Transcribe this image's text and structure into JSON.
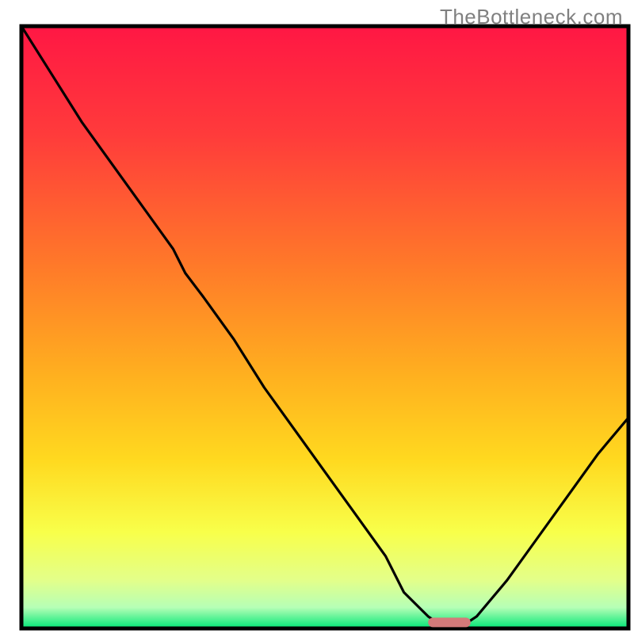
{
  "watermark": "TheBottleneck.com",
  "chart_data": {
    "type": "line",
    "title": "",
    "xlabel": "",
    "ylabel": "",
    "xlim": [
      0,
      100
    ],
    "ylim": [
      0,
      100
    ],
    "legend": false,
    "grid": false,
    "curve": {
      "name": "bottleneck-curve",
      "x": [
        0,
        5,
        10,
        15,
        20,
        25,
        27,
        30,
        35,
        40,
        45,
        50,
        55,
        60,
        63,
        67,
        70,
        72,
        75,
        80,
        85,
        90,
        95,
        100
      ],
      "y": [
        100,
        92,
        84,
        77,
        70,
        63,
        59,
        55,
        48,
        40,
        33,
        26,
        19,
        12,
        6,
        2,
        0,
        0,
        2,
        8,
        15,
        22,
        29,
        35
      ]
    },
    "marker": {
      "name": "optimal-range-marker",
      "x_start": 67,
      "x_end": 74,
      "y": 1.0,
      "color": "#d47a7a"
    },
    "background_gradient": {
      "stops": [
        {
          "offset": 0.0,
          "color": "#ff1744"
        },
        {
          "offset": 0.18,
          "color": "#ff3b3b"
        },
        {
          "offset": 0.4,
          "color": "#ff7a29"
        },
        {
          "offset": 0.58,
          "color": "#ffb01f"
        },
        {
          "offset": 0.72,
          "color": "#ffd91f"
        },
        {
          "offset": 0.84,
          "color": "#f8ff4a"
        },
        {
          "offset": 0.92,
          "color": "#e3ff8a"
        },
        {
          "offset": 0.965,
          "color": "#b6ffb6"
        },
        {
          "offset": 1.0,
          "color": "#00e676"
        }
      ]
    },
    "frame_color": "#000000",
    "curve_color": "#000000"
  }
}
